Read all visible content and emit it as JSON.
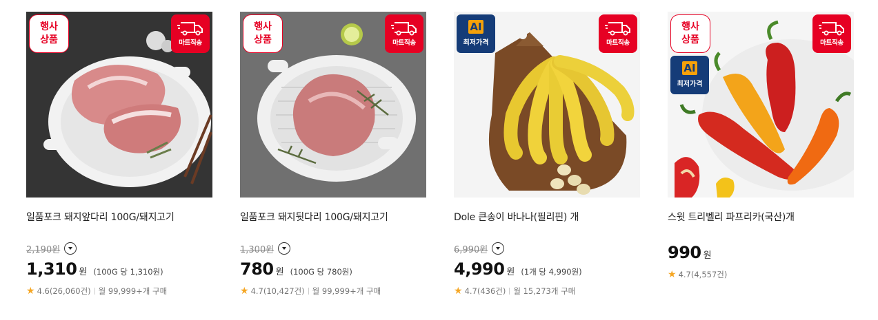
{
  "colors": {
    "accent_red": "#e60023",
    "ai_navy": "#153c78",
    "ai_orange": "#f5a10a",
    "star": "#f5a623"
  },
  "badges": {
    "event_label": "행사\n상품",
    "ai_label": "AI",
    "ai_text": "최저가격",
    "mart_text": "마트직송",
    "truck_icon": "truck-icon"
  },
  "products": [
    {
      "title": "일품포크 돼지앞다리 100G/돼지고기",
      "original_price": "2,190원",
      "price": "1,310",
      "currency": "원",
      "unit_price": "(100G 당 1,310원)",
      "rating": "4.6",
      "reviews": "(26,060건)",
      "monthly": "월 99,999+개 구매"
    },
    {
      "title": "일품포크 돼지뒷다리 100G/돼지고기",
      "original_price": "1,300원",
      "price": "780",
      "currency": "원",
      "unit_price": "(100G 당 780원)",
      "rating": "4.7",
      "reviews": "(10,427건)",
      "monthly": "월 99,999+개 구매"
    },
    {
      "title": "Dole 큰송이 바나나(필리핀) 개",
      "original_price": "6,990원",
      "price": "4,990",
      "currency": "원",
      "unit_price": "(1개 당 4,990원)",
      "rating": "4.7",
      "reviews": "(436건)",
      "monthly": "월 15,273개 구매"
    },
    {
      "title": "스윗 트리벨리 파프리카(국산)개",
      "price": "990",
      "currency": "원",
      "rating": "4.7",
      "reviews": "(4,557건)"
    }
  ]
}
